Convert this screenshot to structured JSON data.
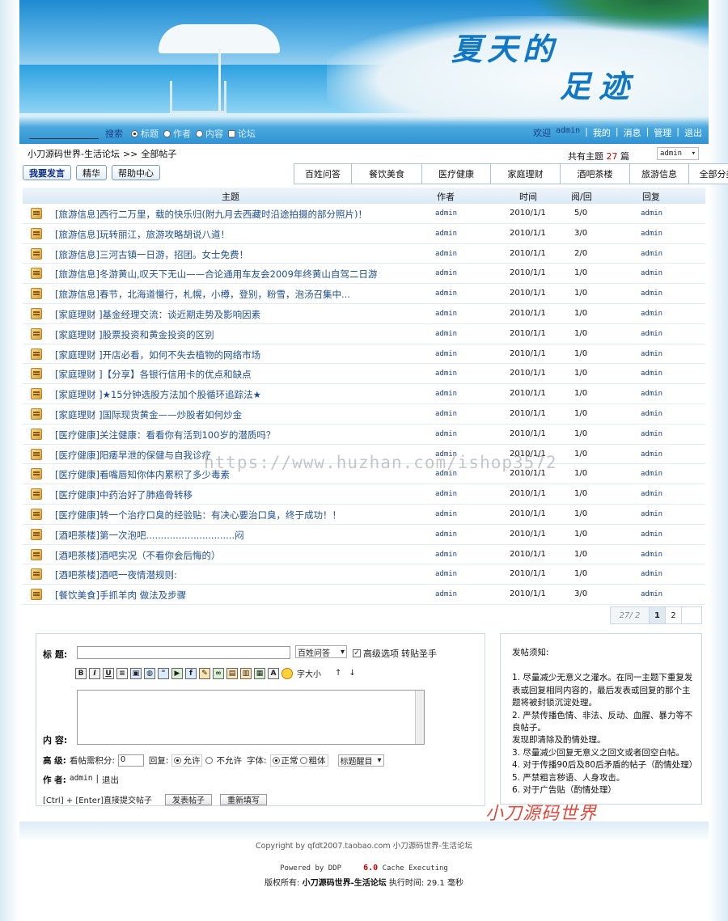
{
  "banner": {
    "title_line1": "夏天的",
    "title_line2": "足迹",
    "search_button": "搜索",
    "search_options": [
      "标题",
      "作者",
      "内容",
      "论坛"
    ],
    "welcome": "欢迎",
    "username": "admin",
    "links": [
      "我的",
      "消息",
      "管理",
      "退出"
    ]
  },
  "breadcrumb": {
    "site": "小刀源码世界-生活论坛",
    "separator": ">>",
    "current": "全部帖子"
  },
  "topic_info": {
    "prefix": "共有主题",
    "count": "27",
    "suffix": "篇"
  },
  "user_select": "admin",
  "action_buttons": [
    "我要发言",
    "精华",
    "帮助中心"
  ],
  "category_tabs": [
    "百姓问答",
    "餐饮美食",
    "医疗健康",
    "家庭理财",
    "酒吧茶楼",
    "旅游信息",
    "全部分类"
  ],
  "table_headers": {
    "subject": "主题",
    "author": "作者",
    "time": "时间",
    "views": "阅/回",
    "reply": "回复"
  },
  "topics": [
    {
      "cat": "[旅游信息]",
      "title": "西行二万里，载的快乐归(附九月去西藏时沿途拍摄的部分照片)！",
      "author": "admin",
      "date": "2010/1/1",
      "rv": "5/0",
      "reply": "admin"
    },
    {
      "cat": "[旅游信息]",
      "title": "玩转丽江，旅游攻略胡说八道！",
      "author": "admin",
      "date": "2010/1/1",
      "rv": "3/0",
      "reply": "admin"
    },
    {
      "cat": "[旅游信息]",
      "title": "三河古镇一日游，招团。女士免费！",
      "author": "admin",
      "date": "2010/1/1",
      "rv": "2/0",
      "reply": "admin"
    },
    {
      "cat": "[旅游信息]",
      "title": "冬游黄山,叹天下无山——合论通用车友会2009年终黄山自驾二日游",
      "author": "admin",
      "date": "2010/1/1",
      "rv": "1/0",
      "reply": "admin"
    },
    {
      "cat": "[旅游信息]",
      "title": "春节，北海道慢行，札幌，小樽，登别，粉雪，泡汤召集中...",
      "author": "admin",
      "date": "2010/1/1",
      "rv": "1/0",
      "reply": "admin"
    },
    {
      "cat": "[家庭理财 ]",
      "title": "基金经理交流：谈近期走势及影响因素",
      "author": "admin",
      "date": "2010/1/1",
      "rv": "1/0",
      "reply": "admin"
    },
    {
      "cat": "[家庭理财 ]",
      "title": "股票投资和黄金投资的区别",
      "author": "admin",
      "date": "2010/1/1",
      "rv": "1/0",
      "reply": "admin"
    },
    {
      "cat": "[家庭理财 ]",
      "title": "开店必看，如何不失去植物的网络市场",
      "author": "admin",
      "date": "2010/1/1",
      "rv": "1/0",
      "reply": "admin"
    },
    {
      "cat": "[家庭理财 ]",
      "title": "【分享】各银行信用卡的优点和缺点",
      "author": "admin",
      "date": "2010/1/1",
      "rv": "1/0",
      "reply": "admin"
    },
    {
      "cat": "[家庭理财 ]",
      "title": "★15分钟选股方法加个股循环追踪法★",
      "author": "admin",
      "date": "2010/1/1",
      "rv": "1/0",
      "reply": "admin"
    },
    {
      "cat": "[家庭理财 ]",
      "title": "国际现货黄金——炒股者如何炒金",
      "author": "admin",
      "date": "2010/1/1",
      "rv": "1/0",
      "reply": "admin"
    },
    {
      "cat": "[医疗健康]",
      "title": "关注健康：看看你有活到100岁的潜质吗？",
      "author": "admin",
      "date": "2010/1/1",
      "rv": "1/0",
      "reply": "admin"
    },
    {
      "cat": "[医疗健康]",
      "title": "阳痿早泄的保健与自我诊疗",
      "author": "admin",
      "date": "2010/1/1",
      "rv": "1/0",
      "reply": "admin"
    },
    {
      "cat": "[医疗健康]",
      "title": "看嘴唇知你体内累积了多少毒素",
      "author": "admin",
      "date": "2010/1/1",
      "rv": "1/0",
      "reply": "admin"
    },
    {
      "cat": "[医疗健康]",
      "title": "中药治好了肺癌骨转移",
      "author": "admin",
      "date": "2010/1/1",
      "rv": "1/0",
      "reply": "admin"
    },
    {
      "cat": "[医疗健康]",
      "title": "转一个治疗口臭的经验贴：有决心要治口臭，终于成功！！",
      "author": "admin",
      "date": "2010/1/1",
      "rv": "1/0",
      "reply": "admin"
    },
    {
      "cat": "[酒吧茶楼]",
      "title": "第一次泡吧..............................闷",
      "author": "admin",
      "date": "2010/1/1",
      "rv": "1/0",
      "reply": "admin"
    },
    {
      "cat": "[酒吧茶楼]",
      "title": "酒吧实况（不看你会后悔的）",
      "author": "admin",
      "date": "2010/1/1",
      "rv": "1/0",
      "reply": "admin"
    },
    {
      "cat": "[酒吧茶楼]",
      "title": "酒吧一夜情潜规则:",
      "author": "admin",
      "date": "2010/1/1",
      "rv": "1/0",
      "reply": "admin"
    },
    {
      "cat": "[餐饮美食]",
      "title": "手抓羊肉 做法及步骤",
      "author": "admin",
      "date": "2010/1/1",
      "rv": "3/0",
      "reply": "admin"
    }
  ],
  "pager": {
    "info": "27/ 2",
    "current": "1",
    "next": "2"
  },
  "post_form": {
    "title_label": "标  题:",
    "category_value": "百姓问答",
    "advanced_label": "高级选项",
    "convert_label": "转贴圣手",
    "font_size_label": "字大小",
    "content_label": "内  容:",
    "advanced_section": "高  级:",
    "points_label": "看帖需积分:",
    "points_value": "0",
    "reply_label": "回复:",
    "allow": "允许",
    "disallow": "不允许",
    "font_label": "字体:",
    "normal": "正常",
    "bold": "粗体",
    "highlight_select": "标题醒目",
    "author_label": "作  者:",
    "author_name": "admin",
    "logout": "退出",
    "shortcut": "[Ctrl] + [Enter]直接提交帖子",
    "submit": "发表帖子",
    "reset": "重新填写"
  },
  "notice": {
    "title": "发帖须知:",
    "lines": [
      "1. 尽量减少无意义之灌水。在同一主题下重复发表或回复相同内容的，最后发表或回复的那个主题将被封锁沉淀处理。",
      "2. 严禁传播色情、非法、反动、血腥、暴力等不良帖子。",
      "发现即清除及酌情处理。",
      "3. 尽量减少回复无意义之回文或者回空白帖。",
      "4. 对于传播90后及80后矛盾的帖子（酌情处理）",
      "5. 严禁粗言秽语、人身攻击。",
      "6. 对于广告贴（酌情处理）"
    ]
  },
  "watermark_text": "小刀源码世界",
  "url_watermark": "https://www.huzhan.com/ishop3572",
  "footer": {
    "copyright": "Copyright by qfdt2007.taobao.com 小刀源码世界-生活论坛",
    "powered_prefix": "Powered by DDP",
    "version": "6.0",
    "powered_suffix": "Cache Executing",
    "rights_label": "版权所有:",
    "rights_owner": "小刀源码世界-生活论坛",
    "exec_label": "执行时间:",
    "exec_value": "29.1 毫秒"
  },
  "colors": {
    "accent": "#1f4f8f",
    "banner_blue": "#1378c4",
    "count_red": "#cc0000",
    "watermark_red": "#e04a3c"
  }
}
